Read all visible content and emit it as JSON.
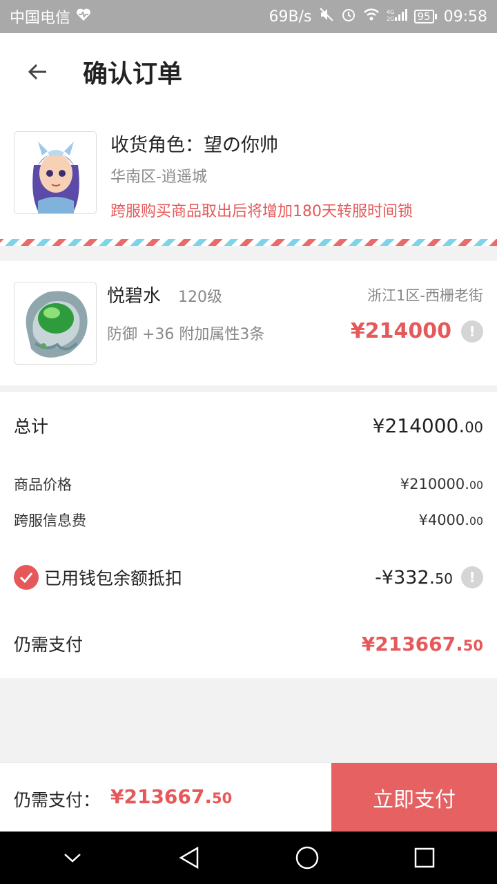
{
  "status_bar": {
    "carrier": "中国电信",
    "speed": "69B/s",
    "network": "4G 2G",
    "battery": "95",
    "time": "09:58"
  },
  "header": {
    "title": "确认订单"
  },
  "recipient": {
    "name": "收货角色：望の你帅",
    "server": "华南区-逍遥城",
    "warning": "跨服购买商品取出后将增加180天转服时间锁"
  },
  "product": {
    "name": "悦碧水",
    "level": "120级",
    "attrs": "防御 +36  附加属性3条",
    "server": "浙江1区-西栅老街",
    "price": "¥214000"
  },
  "summary": {
    "total_label": "总计",
    "total_value": "¥214000.",
    "total_cents": "00",
    "goods_label": "商品价格",
    "goods_value": "¥210000.",
    "goods_cents": "00",
    "fee_label": "跨服信息费",
    "fee_value": "¥4000.",
    "fee_cents": "00",
    "wallet_label": "已用钱包余额抵扣",
    "wallet_value": "-¥332.",
    "wallet_cents": "50",
    "wallet_checked": true,
    "need_label": "仍需支付",
    "need_value": "¥213667.",
    "need_cents": "50"
  },
  "bottom_bar": {
    "label": "仍需支付：",
    "value": "¥213667.",
    "cents": "50",
    "pay_label": "立即支付"
  },
  "colors": {
    "accent": "#e6595a",
    "pay_button": "#e66262",
    "status_bar": "#a9a9a9"
  },
  "icons": [
    "heart-pulse-icon",
    "mute-icon",
    "alarm-icon",
    "wifi-icon",
    "signal-icon",
    "battery-icon",
    "back-arrow-icon",
    "info-icon",
    "check-icon",
    "nav-down-icon",
    "nav-back-icon",
    "nav-home-icon",
    "nav-recent-icon"
  ]
}
